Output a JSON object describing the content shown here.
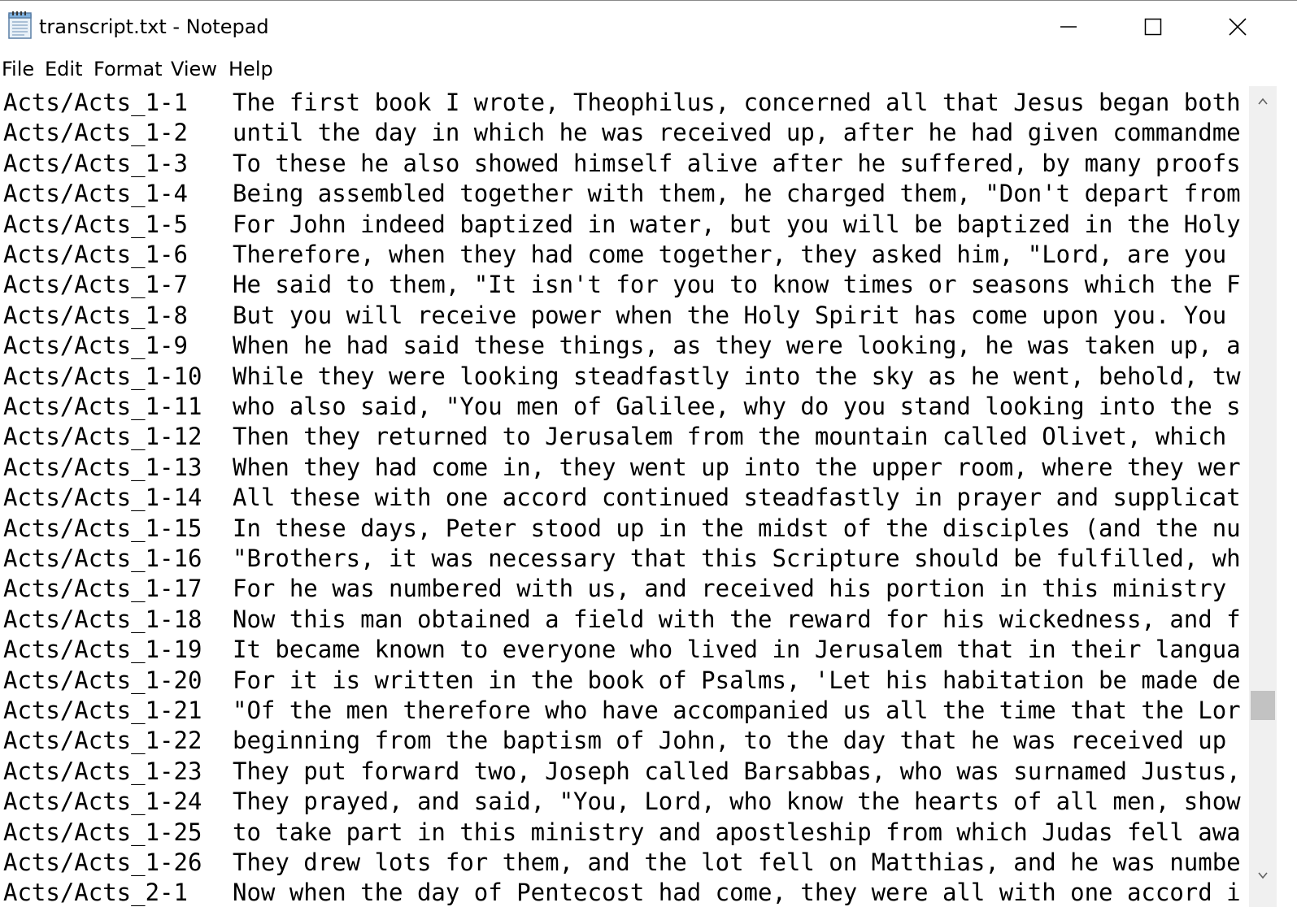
{
  "window": {
    "title": "transcript.txt - Notepad",
    "controls": {
      "minimize": "minimize-icon",
      "maximize": "maximize-icon",
      "close": "close-icon"
    }
  },
  "menu": [
    "File",
    "Edit",
    "Format",
    "View",
    "Help"
  ],
  "editor": {
    "lines": [
      {
        "ref": "Acts/Acts_1-1",
        "text": "The first book I wrote, Theophilus, concerned all that Jesus began both"
      },
      {
        "ref": "Acts/Acts_1-2",
        "text": "until the day in which he was received up, after he had given commandme"
      },
      {
        "ref": "Acts/Acts_1-3",
        "text": "To these he also showed himself alive after he suffered, by many proofs"
      },
      {
        "ref": "Acts/Acts_1-4",
        "text": "Being assembled together with them, he charged them, \"Don't depart from"
      },
      {
        "ref": "Acts/Acts_1-5",
        "text": "For John indeed baptized in water, but you will be baptized in the Holy"
      },
      {
        "ref": "Acts/Acts_1-6",
        "text": "Therefore, when they had come together, they asked him, \"Lord, are you"
      },
      {
        "ref": "Acts/Acts_1-7",
        "text": "He said to them, \"It isn't for you to know times or seasons which the F"
      },
      {
        "ref": "Acts/Acts_1-8",
        "text": "But you will receive power when the Holy Spirit has come upon you. You"
      },
      {
        "ref": "Acts/Acts_1-9",
        "text": "When he had said these things, as they were looking, he was taken up, a"
      },
      {
        "ref": "Acts/Acts_1-10",
        "text": "While they were looking steadfastly into the sky as he went, behold, tw"
      },
      {
        "ref": "Acts/Acts_1-11",
        "text": "who also said, \"You men of Galilee, why do you stand looking into the s"
      },
      {
        "ref": "Acts/Acts_1-12",
        "text": "Then they returned to Jerusalem from the mountain called Olivet, which"
      },
      {
        "ref": "Acts/Acts_1-13",
        "text": "When they had come in, they went up into the upper room, where they wer"
      },
      {
        "ref": "Acts/Acts_1-14",
        "text": "All these with one accord continued steadfastly in prayer and supplicat"
      },
      {
        "ref": "Acts/Acts_1-15",
        "text": "In these days, Peter stood up in the midst of the disciples (and the nu"
      },
      {
        "ref": "Acts/Acts_1-16",
        "text": "\"Brothers, it was necessary that this Scripture should be fulfilled, wh"
      },
      {
        "ref": "Acts/Acts_1-17",
        "text": "For he was numbered with us, and received his portion in this ministry"
      },
      {
        "ref": "Acts/Acts_1-18",
        "text": "Now this man obtained a field with the reward for his wickedness, and f"
      },
      {
        "ref": "Acts/Acts_1-19",
        "text": "It became known to everyone who lived in Jerusalem that in their langua"
      },
      {
        "ref": "Acts/Acts_1-20",
        "text": "For it is written in the book of Psalms, 'Let his habitation be made de"
      },
      {
        "ref": "Acts/Acts_1-21",
        "text": "\"Of the men therefore who have accompanied us all the time that the Lor"
      },
      {
        "ref": "Acts/Acts_1-22",
        "text": "beginning from the baptism of John, to the day that he was received up"
      },
      {
        "ref": "Acts/Acts_1-23",
        "text": "They put forward two, Joseph called Barsabbas, who was surnamed Justus,"
      },
      {
        "ref": "Acts/Acts_1-24",
        "text": "They prayed, and said, \"You, Lord, who know the hearts of all men, show"
      },
      {
        "ref": "Acts/Acts_1-25",
        "text": "to take part in this ministry and apostleship from which Judas fell awa"
      },
      {
        "ref": "Acts/Acts_1-26",
        "text": "They drew lots for them, and the lot fell on Matthias, and he was numbe"
      },
      {
        "ref": "Acts/Acts_2-1",
        "text": "Now when the day of Pentecost had come, they were all with one accord i"
      }
    ]
  },
  "scrollbar": {
    "up": "chevron-up-icon",
    "down": "chevron-down-icon",
    "position_fraction": 0.8
  }
}
